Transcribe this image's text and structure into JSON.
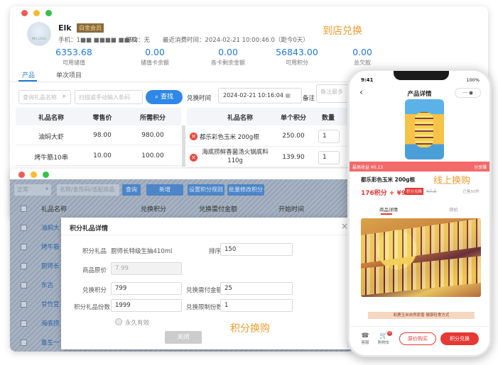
{
  "store_window": {
    "title": "到店兑换",
    "customer": {
      "name": "Elk",
      "level": "白金会员",
      "avatar_text": "IMG LOGO",
      "phone": "手机：1■■ ■■■■ ■■92",
      "guide": "导购：无",
      "last_purchase": "最近消费时间：2024-02-21 10:00:46.0（距今0天）"
    },
    "stats": [
      {
        "value": "6353.68",
        "label": "可用储值"
      },
      {
        "value": "0.00",
        "label": "储值卡余额"
      },
      {
        "value": "0.00",
        "label": "各卡剩余金额"
      },
      {
        "value": "56843.00",
        "label": "可用积分"
      },
      {
        "value": "0.00",
        "label": "总欠款"
      }
    ],
    "tabs": [
      "产品",
      "单次项目"
    ],
    "search": {
      "name_placeholder": "查询礼品名称",
      "scan_placeholder": "扫描或手动输入条码",
      "button": "查找"
    },
    "redeem_time_label": "兑换时间",
    "redeem_time_value": "2024-02-21 10:16:04",
    "remark_label": "备注",
    "remark_placeholder": "备注最多",
    "left_table": {
      "headers": [
        "礼品名称",
        "零售价",
        "所需积分"
      ],
      "rows": [
        {
          "name": "油焖大虾",
          "price": "98.00",
          "points": "980.00"
        },
        {
          "name": "烤牛筋10串",
          "price": "10.00",
          "points": "100.00"
        }
      ]
    },
    "right_table": {
      "headers": [
        "礼品名称",
        "单个积分",
        "数量"
      ],
      "rows": [
        {
          "name": "都乐彩色玉米 200g根",
          "points": "250.00",
          "qty": "1"
        },
        {
          "name": "海底捞鲜香菌汤火锅底料110g",
          "points": "139.90",
          "qty": "1"
        }
      ]
    }
  },
  "admin_window": {
    "title": "积分换购",
    "toolbar": {
      "status": "正常",
      "search_placeholder": "名称/条形码/适配商品",
      "btn_search": "查询",
      "btn_add": "新增",
      "btn_rule": "设置积分规则",
      "btn_batch": "批量修改积分"
    },
    "headers": [
      "礼品名称",
      "兑换积分",
      "兑换需付金额",
      "开始时间"
    ],
    "rows": [
      "油焖大",
      "烤牛筋",
      "厨师长",
      "东古",
      "甘竹豆",
      "海底捞",
      "鲁生一"
    ],
    "modal": {
      "title": "积分礼品详情",
      "close": "×",
      "fields": {
        "gift_label": "积分礼品",
        "gift_value": "厨师长特级生抽410ml",
        "sort_label": "排序",
        "sort_value": "150",
        "price_label": "商品原价",
        "price_value": "7.99",
        "points_label": "兑换积分",
        "points_value": "799",
        "pay_label": "兑换需付金额",
        "pay_value": "25",
        "count_label": "积分礼品份数",
        "count_value": "1999",
        "limit_label": "兑换限制份数",
        "limit_value": "1"
      },
      "forever": "永久有效",
      "close_btn": "关闭"
    }
  },
  "phone": {
    "title": "线上换购",
    "status_time": "9:41",
    "battery": "100%",
    "nav_title": "产品详情",
    "nav_capsule": "··· ◉",
    "promo": "最高收益 ¥0.13",
    "share": "分享赚",
    "product_name": "都乐彩色玉米 200g根",
    "price": "176积分 + ¥9.9",
    "tag": "积分兑换",
    "old_price": "¥7.5",
    "sold": "已售50件",
    "detail_tabs": [
      "商品详情",
      "评价"
    ],
    "banner": "彩鹿玉米自然原香 健康轻食方式",
    "bar": {
      "service": "客服",
      "cart": "购物车",
      "cart_count": "0",
      "buy": "原价购买",
      "redeem": "积分兑换"
    }
  }
}
